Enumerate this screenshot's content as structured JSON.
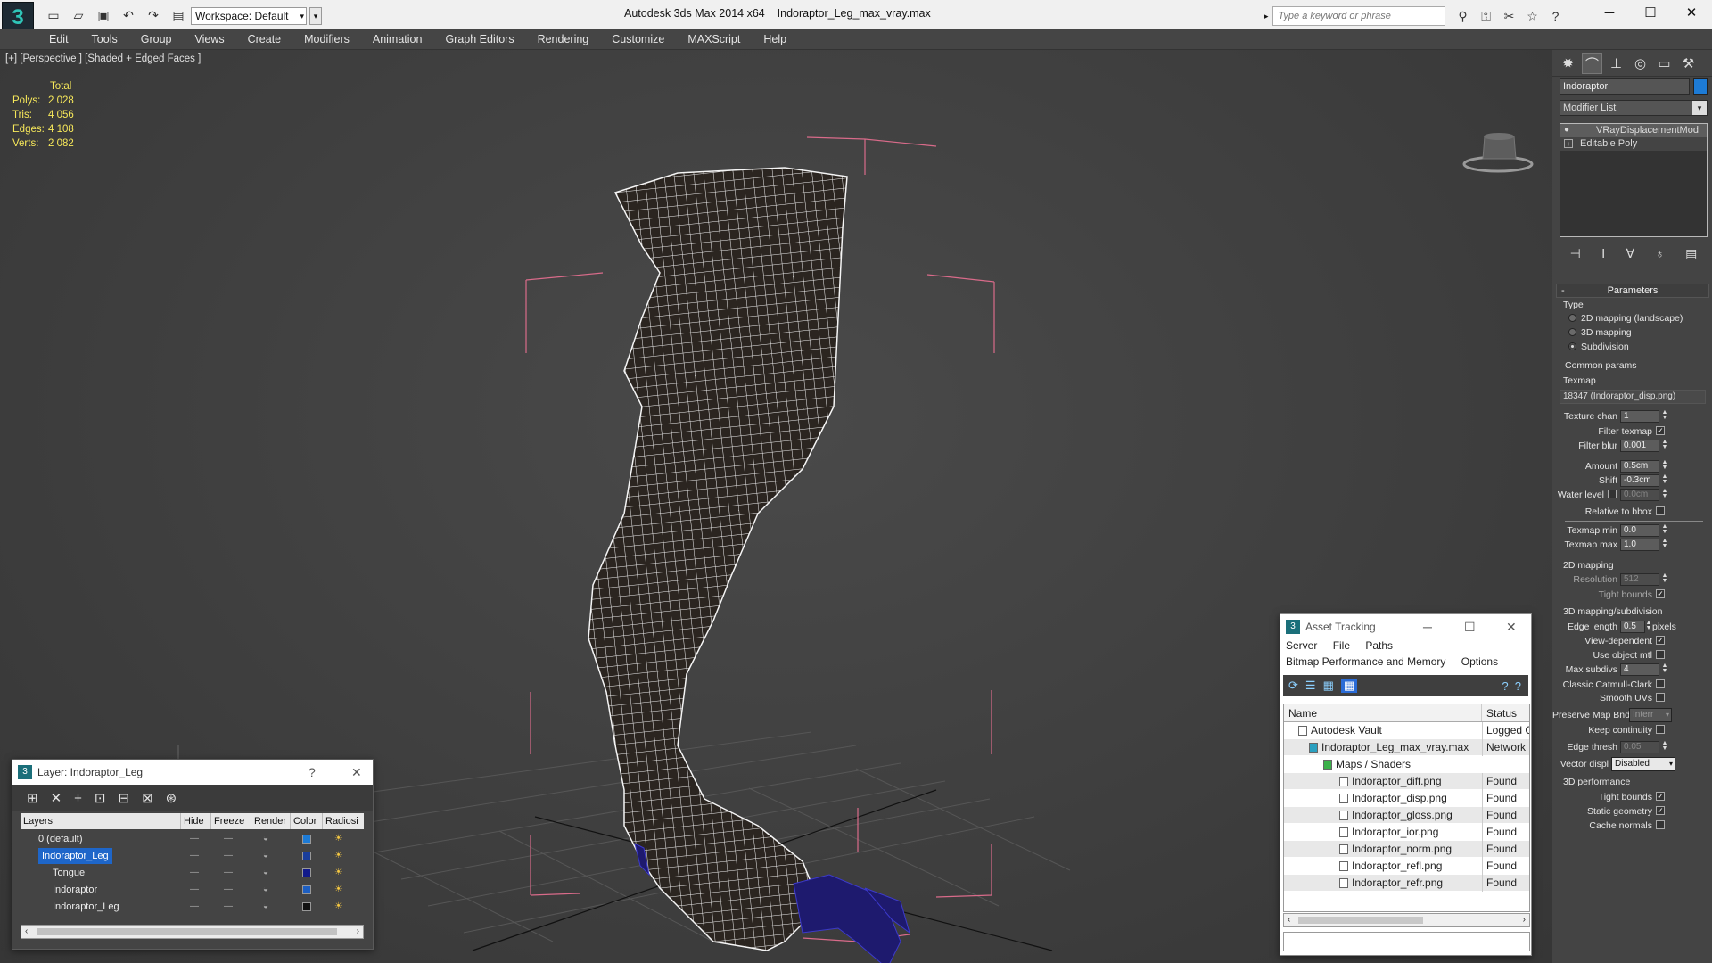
{
  "app": {
    "title": "Autodesk 3ds Max  2014 x64",
    "file": "Indoraptor_Leg_max_vray.max",
    "workspace": "Workspace: Default",
    "search_placeholder": "Type a keyword or phrase"
  },
  "menu": [
    "Edit",
    "Tools",
    "Group",
    "Views",
    "Create",
    "Modifiers",
    "Animation",
    "Graph Editors",
    "Rendering",
    "Customize",
    "MAXScript",
    "Help"
  ],
  "viewport": {
    "label": "[+] [Perspective ] [Shaded + Edged Faces ]",
    "stats_header": "Total",
    "stats": [
      {
        "k": "Polys:",
        "v": "2 028"
      },
      {
        "k": "Tris:",
        "v": "4 056"
      },
      {
        "k": "Edges:",
        "v": "4 108"
      },
      {
        "k": "Verts:",
        "v": "2 082"
      }
    ]
  },
  "command_panel": {
    "object_name": "Indoraptor",
    "object_color": "#1d7bd6",
    "modifier_list": "Modifier List",
    "stack": [
      "VRayDisplacementMod",
      "Editable Poly"
    ],
    "params_title": "Parameters",
    "type_label": "Type",
    "type_options": [
      "2D mapping (landscape)",
      "3D mapping",
      "Subdivision"
    ],
    "type_selected": 2,
    "common_params": "Common params",
    "texmap_label": "Texmap",
    "texmap_value": "18347 (Indoraptor_disp.png)",
    "texture_chan_label": "Texture chan",
    "texture_chan": "1",
    "filter_texmap": "Filter texmap",
    "filter_blur_label": "Filter blur",
    "filter_blur": "0.001",
    "amount_label": "Amount",
    "amount": "0.5cm",
    "shift_label": "Shift",
    "shift": "-0.3cm",
    "water_level_label": "Water level",
    "water_level": "0.0cm",
    "relative_bbox": "Relative to bbox",
    "texmap_min_label": "Texmap min",
    "texmap_min": "0.0",
    "texmap_max_label": "Texmap max",
    "texmap_max": "1.0",
    "mapping2d_title": "2D mapping",
    "resolution_label": "Resolution",
    "resolution": "512",
    "tight_bounds": "Tight bounds",
    "mapping3d_title": "3D mapping/subdivision",
    "edge_length_label": "Edge length",
    "edge_length": "0.5",
    "pixels": "pixels",
    "view_dependent": "View-dependent",
    "use_object_mtl": "Use object mtl",
    "max_subdivs_label": "Max subdivs",
    "max_subdivs": "4",
    "classic_catmull": "Classic Catmull-Clark",
    "smooth_uvs": "Smooth UVs",
    "preserve_map_bnd": "Preserve Map Bnd",
    "preserve_map_value": "Interr",
    "keep_continuity": "Keep continuity",
    "edge_thresh_label": "Edge thresh",
    "edge_thresh": "0.05",
    "vector_displ_label": "Vector displ",
    "vector_displ": "Disabled",
    "perf_title": "3D performance",
    "tight_bounds2": "Tight bounds",
    "static_geometry": "Static geometry",
    "cache_normals": "Cache normals"
  },
  "layer_window": {
    "title": "Layer: Indoraptor_Leg",
    "help": "?",
    "columns": [
      "Layers",
      "Hide",
      "Freeze",
      "Render",
      "Color",
      "Radiosi"
    ],
    "rows": [
      {
        "name": "0 (default)",
        "color": "#1d7bd6",
        "level": 0,
        "selected": false
      },
      {
        "name": "Indoraptor_Leg",
        "color": "#1a3e9c",
        "level": 0,
        "selected": true
      },
      {
        "name": "Tongue",
        "color": "#121a8a",
        "level": 1,
        "selected": false
      },
      {
        "name": "Indoraptor",
        "color": "#1d5fc2",
        "level": 1,
        "selected": false
      },
      {
        "name": "Indoraptor_Leg",
        "color": "#111111",
        "level": 1,
        "selected": false
      }
    ]
  },
  "asset_window": {
    "title": "Asset Tracking",
    "menu": [
      "Server",
      "File",
      "Paths"
    ],
    "menu2": [
      "Bitmap Performance and Memory",
      "Options"
    ],
    "columns": [
      "Name",
      "Status"
    ],
    "rows": [
      {
        "name": "Autodesk Vault",
        "status": "Logged C",
        "indent": 0
      },
      {
        "name": "Indoraptor_Leg_max_vray.max",
        "status": "Network I",
        "indent": 1
      },
      {
        "name": "Maps / Shaders",
        "status": "",
        "indent": 2
      },
      {
        "name": "Indoraptor_diff.png",
        "status": "Found",
        "indent": 3
      },
      {
        "name": "Indoraptor_disp.png",
        "status": "Found",
        "indent": 3
      },
      {
        "name": "Indoraptor_gloss.png",
        "status": "Found",
        "indent": 3
      },
      {
        "name": "Indoraptor_ior.png",
        "status": "Found",
        "indent": 3
      },
      {
        "name": "Indoraptor_norm.png",
        "status": "Found",
        "indent": 3
      },
      {
        "name": "Indoraptor_refl.png",
        "status": "Found",
        "indent": 3
      },
      {
        "name": "Indoraptor_refr.png",
        "status": "Found",
        "indent": 3
      }
    ]
  }
}
